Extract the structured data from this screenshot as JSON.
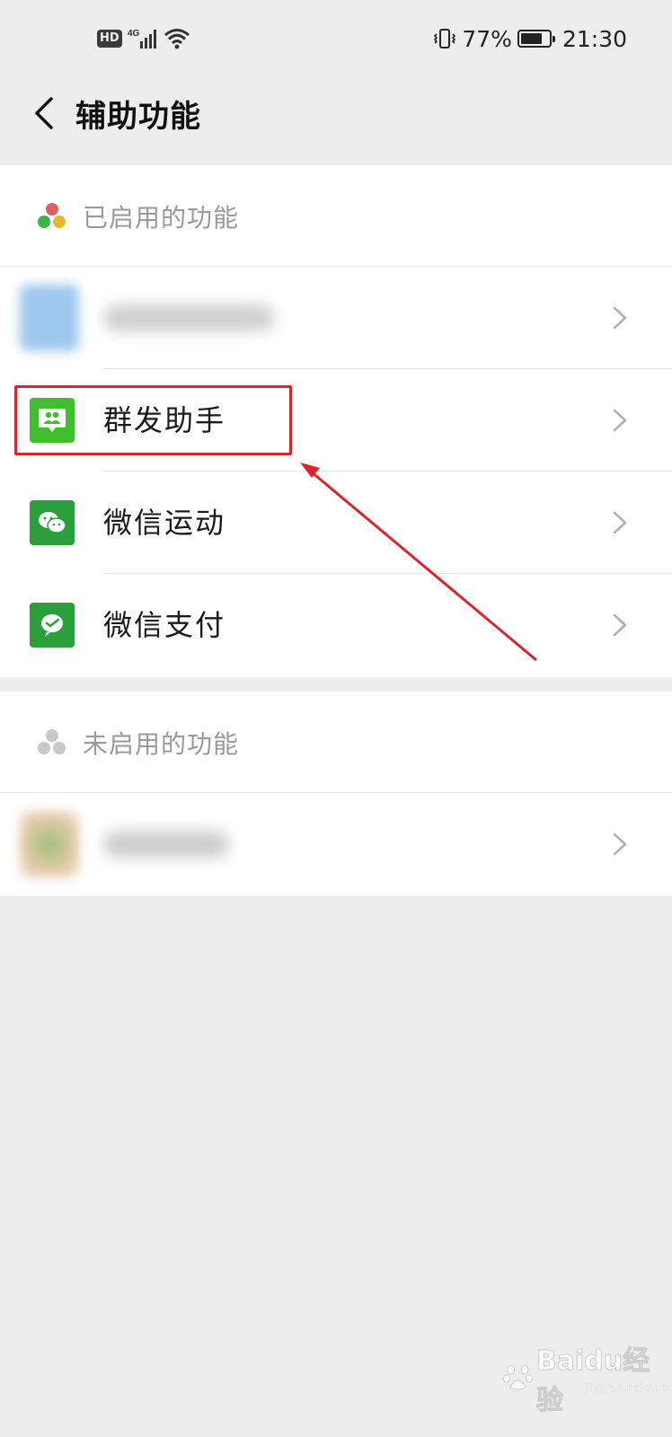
{
  "status_bar": {
    "hd": "HD",
    "network": "4G",
    "battery_pct": "77%",
    "battery_level": 0.77,
    "time": "21:30"
  },
  "nav": {
    "title": "辅助功能",
    "back_icon": "chevron-left-icon"
  },
  "enabled_section": {
    "header": "已启用的功能",
    "header_icon": "three-dots-color-icon",
    "items": [
      {
        "label": "",
        "icon": "blurred-app-icon",
        "blurred": true
      },
      {
        "label": "群发助手",
        "icon": "group-broadcast-icon",
        "color": "#3fbf2b"
      },
      {
        "label": "微信运动",
        "icon": "wechat-sport-icon",
        "color": "#2c9f3d"
      },
      {
        "label": "微信支付",
        "icon": "wechat-pay-icon",
        "color": "#2c9f3d"
      }
    ]
  },
  "disabled_section": {
    "header": "未启用的功能",
    "header_icon": "three-dots-gray-icon",
    "items": [
      {
        "label": "",
        "icon": "blurred-app-icon",
        "blurred": true
      }
    ]
  },
  "annotation": {
    "highlight_color": "#d8262e"
  },
  "watermark": {
    "brand": "Baidu经验",
    "url": "jingyan.baidu.com"
  },
  "colors": {
    "background": "#ededed",
    "card": "#ffffff",
    "header_text": "#9a9a9a",
    "accent_green": "#2c9f3d"
  }
}
